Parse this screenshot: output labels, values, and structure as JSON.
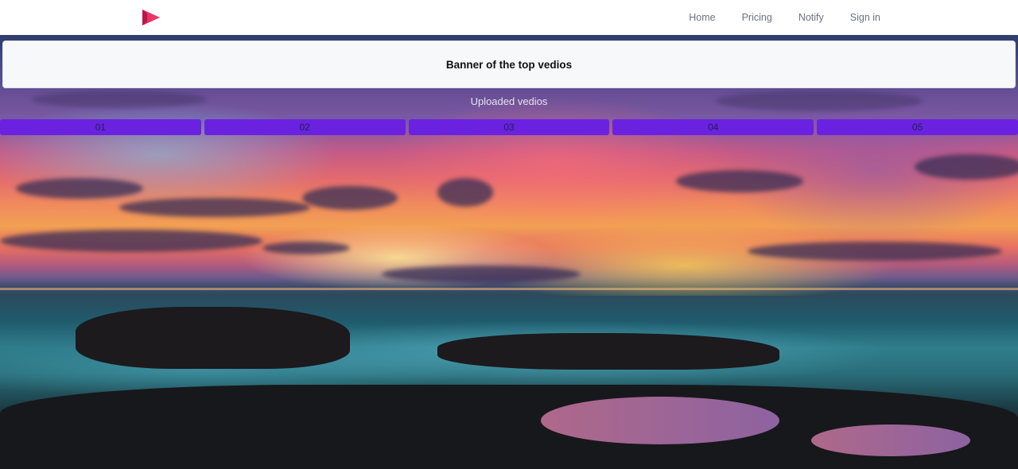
{
  "navbar": {
    "logo_icon": "play-logo-icon",
    "logo_colors": [
      "#e0245e",
      "#b8154a"
    ],
    "links": [
      {
        "label": "Home"
      },
      {
        "label": "Pricing"
      },
      {
        "label": "Notify"
      },
      {
        "label": "Sign in"
      }
    ]
  },
  "banner": {
    "title": "Banner of the top vedios"
  },
  "uploaded": {
    "label": "Uploaded vedios",
    "accent_color": "#6a22e0",
    "items": [
      {
        "label": "01"
      },
      {
        "label": "02"
      },
      {
        "label": "03"
      },
      {
        "label": "04"
      },
      {
        "label": "05"
      }
    ]
  },
  "hero": {
    "image": "sunset-seascape-background"
  }
}
